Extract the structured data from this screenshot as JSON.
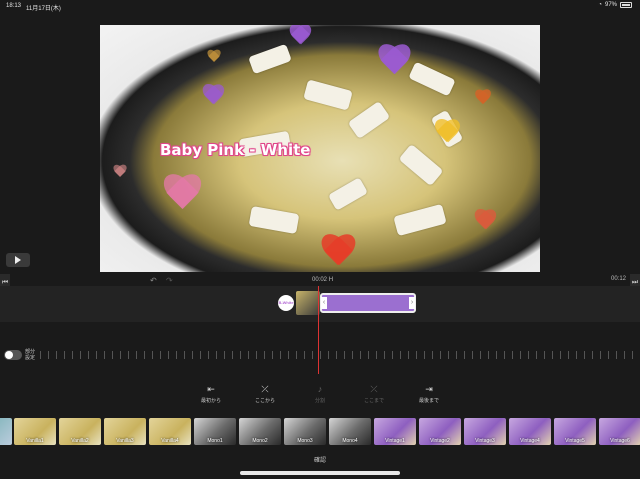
{
  "status_bar": {
    "time": "18:13",
    "date": "11月17日(木)",
    "battery": "97%"
  },
  "preview": {
    "caption": "Baby Pink - White"
  },
  "playback": {
    "current": "00:02",
    "current_suffix": "H",
    "duration": "00:12"
  },
  "clip": {
    "marker": "B-White"
  },
  "toggle": {
    "label": "部分\n設定",
    "on": false
  },
  "tools": [
    {
      "label": "最初から",
      "icon": "trim-start-icon",
      "enabled": true
    },
    {
      "label": "ここから",
      "icon": "split-from-icon",
      "enabled": true
    },
    {
      "label": "分割",
      "icon": "split-icon",
      "enabled": false
    },
    {
      "label": "ここまで",
      "icon": "split-to-icon",
      "enabled": false
    },
    {
      "label": "最後まで",
      "icon": "trim-end-icon",
      "enabled": true
    }
  ],
  "filters": [
    {
      "label": "Vanilla1",
      "style": "vanilla"
    },
    {
      "label": "Vanilla2",
      "style": "vanilla"
    },
    {
      "label": "Vanilla3",
      "style": "vanilla"
    },
    {
      "label": "Vanilla4",
      "style": "vanilla"
    },
    {
      "label": "Mono1",
      "style": "mono"
    },
    {
      "label": "Mono2",
      "style": "mono"
    },
    {
      "label": "Mono3",
      "style": "mono"
    },
    {
      "label": "Mono4",
      "style": "mono"
    },
    {
      "label": "Vintage1",
      "style": "vintage"
    },
    {
      "label": "Vintage2",
      "style": "vintage"
    },
    {
      "label": "Vintage3",
      "style": "vintage"
    },
    {
      "label": "Vintage4",
      "style": "vintage"
    },
    {
      "label": "Vintage5",
      "style": "vintage"
    },
    {
      "label": "Vintage6",
      "style": "vintage"
    }
  ],
  "confirm_label": "確認",
  "colors": {
    "accent_purple": "#9b6fd0",
    "caption_pink": "#e0478a",
    "playhead": "#dd3333"
  }
}
